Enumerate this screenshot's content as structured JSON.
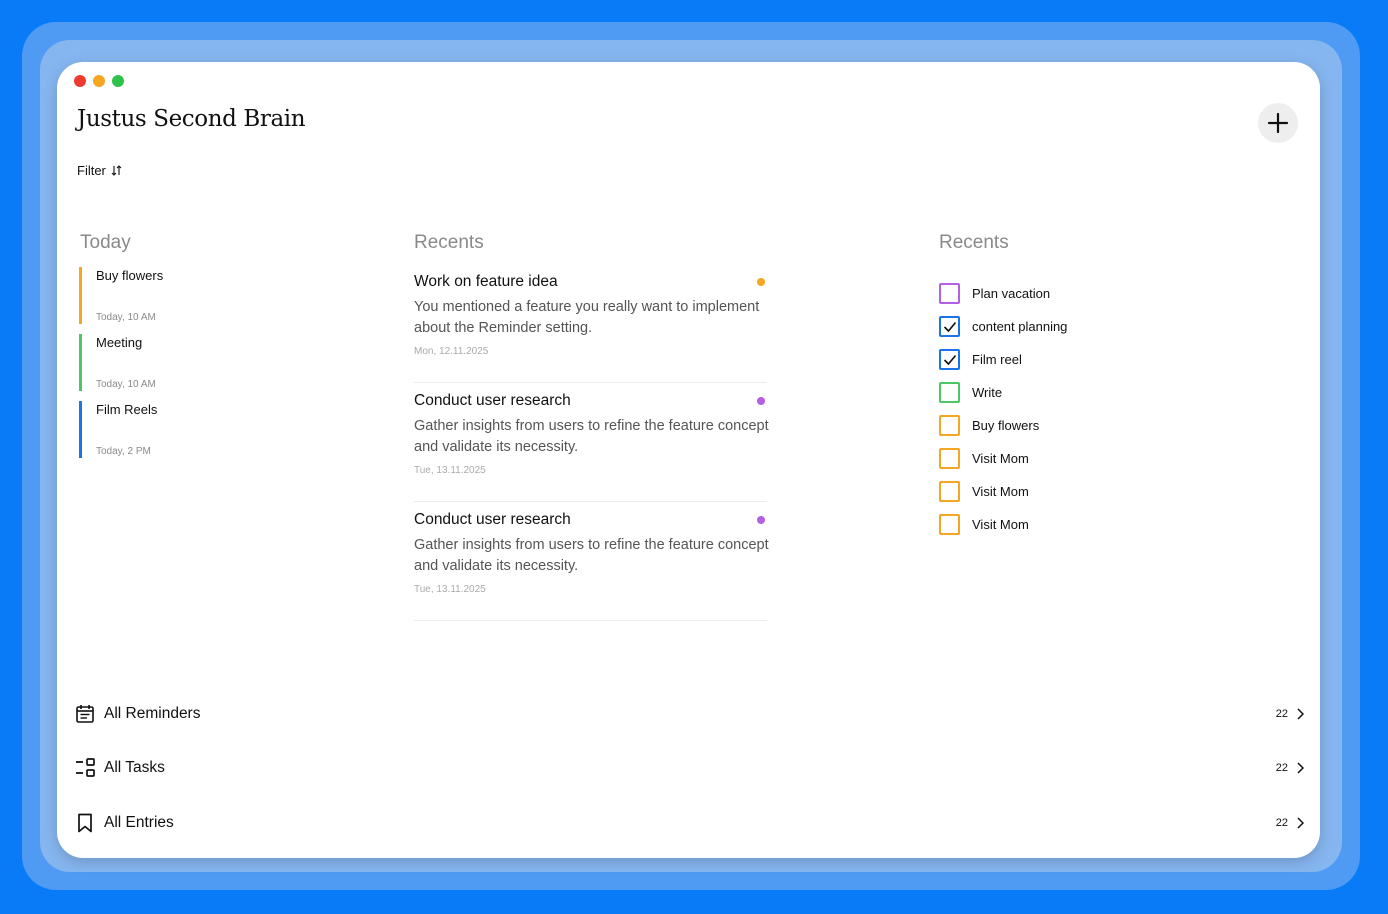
{
  "app": {
    "title": "Justus Second Brain"
  },
  "filter": {
    "label": "Filter"
  },
  "today": {
    "heading": "Today",
    "items": [
      {
        "title": "Buy flowers",
        "time": "Today, 10 AM",
        "color": "#f5a623"
      },
      {
        "title": "Meeting",
        "time": "Today, 10 AM",
        "color": "#4cc764"
      },
      {
        "title": "Film Reels",
        "time": "Today, 2 PM",
        "color": "#1a73e8"
      }
    ]
  },
  "recents_entries": {
    "heading": "Recents",
    "items": [
      {
        "title": "Work on feature idea",
        "body": "You mentioned a feature you really want to implement about the Reminder setting.",
        "date": "Mon, 12.11.2025",
        "dot_color": "#f5a623"
      },
      {
        "title": "Conduct user research",
        "body": "Gather insights from users to refine the feature concept and validate its necessity.",
        "date": "Tue, 13.11.2025",
        "dot_color": "#b55ee6"
      },
      {
        "title": "Conduct user research",
        "body": "Gather insights from users to refine the feature concept and validate its necessity.",
        "date": "Tue, 13.11.2025",
        "dot_color": "#b55ee6"
      }
    ]
  },
  "recents_tasks": {
    "heading": "Recents",
    "items": [
      {
        "label": "Plan vacation",
        "checked": false,
        "color": "#b55ee6"
      },
      {
        "label": "content planning",
        "checked": true,
        "color": "#1a73e8"
      },
      {
        "label": "Film reel",
        "checked": true,
        "color": "#1a73e8"
      },
      {
        "label": "Write",
        "checked": false,
        "color": "#4cc764"
      },
      {
        "label": "Buy flowers",
        "checked": false,
        "color": "#f5a623"
      },
      {
        "label": "Visit Mom",
        "checked": false,
        "color": "#f5a623"
      },
      {
        "label": "Visit Mom",
        "checked": false,
        "color": "#f5a623"
      },
      {
        "label": "Visit Mom",
        "checked": false,
        "color": "#f5a623"
      }
    ]
  },
  "nav": [
    {
      "label": "All Reminders",
      "count": "22",
      "icon": "calendar-icon"
    },
    {
      "label": "All Tasks",
      "count": "22",
      "icon": "tasks-icon"
    },
    {
      "label": "All Entries",
      "count": "22",
      "icon": "bookmark-icon"
    }
  ]
}
